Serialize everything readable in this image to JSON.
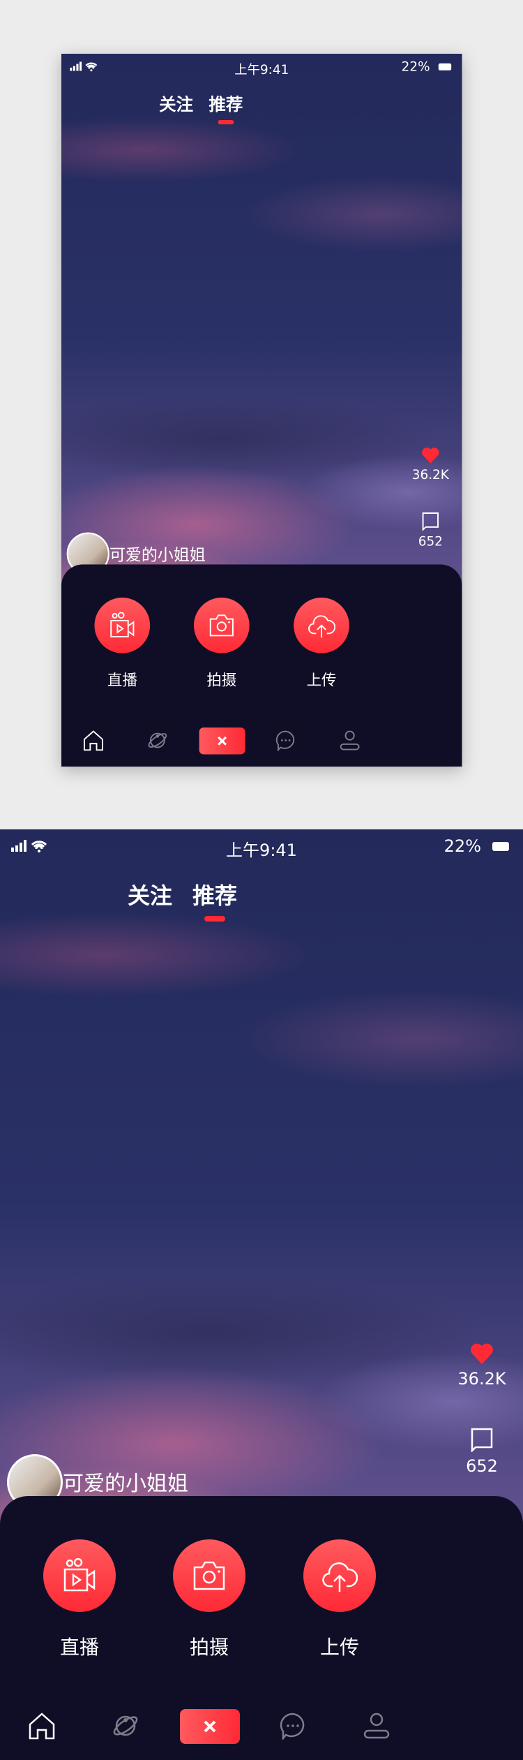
{
  "status": {
    "time": "上午9:41",
    "battery": "22%"
  },
  "tabs": [
    {
      "label": "关注"
    },
    {
      "label": "推荐",
      "active": true
    }
  ],
  "side": {
    "likes": "36.2K",
    "comments": "652"
  },
  "user": {
    "name": "可爱的小姐姐"
  },
  "actions": [
    {
      "label": "直播",
      "icon": "video-camera-icon"
    },
    {
      "label": "拍摄",
      "icon": "camera-icon"
    },
    {
      "label": "上传",
      "icon": "cloud-upload-icon"
    }
  ],
  "nav": [
    {
      "icon": "home-icon"
    },
    {
      "icon": "planet-icon"
    },
    {
      "icon": "close-icon"
    },
    {
      "icon": "message-icon"
    },
    {
      "icon": "profile-icon"
    }
  ],
  "colors": {
    "accent": "#ff2a36",
    "sheet": "#100d26"
  }
}
